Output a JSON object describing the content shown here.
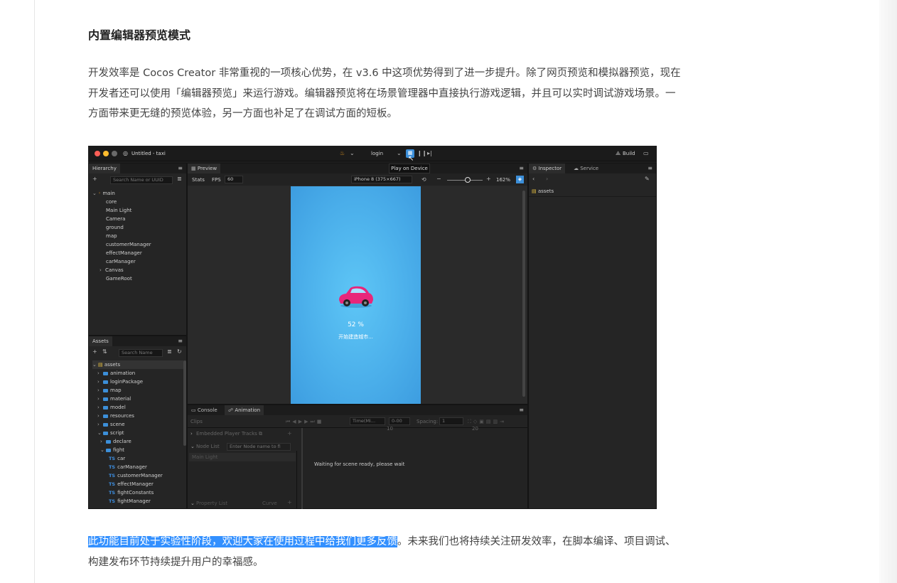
{
  "article": {
    "title": "内置编辑器预览模式",
    "paragraph1": "开发效率是 Cocos Creator 非常重视的一项核心优势，在 v3.6 中这项优势得到了进一步提升。除了网页预览和模拟器预览，现在开发者还可以使用「编辑器预览」来运行游戏。编辑器预览将在场景管理器中直接执行游戏逻辑，并且可以实时调试游戏场景。一方面带来更无缝的预览体验，另一方面也补足了在调试方面的短板。",
    "paragraph2_highlight": "此功能目前处于实验性阶段，欢迎大家在使用过程中给我们更多反馈",
    "paragraph2_rest": "。未来我们也将持续关注研发效率，在脚本编译、项目调试、构建发布环节持续提升用户的幸福感。"
  },
  "editor": {
    "window_title": "Untitled - taxi",
    "scene_select": "login",
    "tooltip": "Play on Device",
    "build_label": "Build",
    "hierarchy": {
      "tab": "Hierarchy",
      "search_placeholder": "Search Name or UUID",
      "root": "main",
      "items": [
        "core",
        "Main Light",
        "Camera",
        "ground",
        "map",
        "customerManager",
        "effectManager",
        "carManager",
        "Canvas",
        "GameRoot"
      ]
    },
    "assets": {
      "tab": "Assets",
      "search_placeholder": "Search Name",
      "root": "assets",
      "folders": [
        "animation",
        "loginPackage",
        "map",
        "material",
        "model",
        "resources",
        "scene",
        "script"
      ],
      "script_children": [
        "declare",
        "fight"
      ],
      "ts_label": "TS",
      "files": [
        "car",
        "carManager",
        "customerManager",
        "effectManager",
        "fightConstants",
        "fightManager"
      ]
    },
    "preview": {
      "tab": "Preview",
      "stats_label": "Stats",
      "fps_label": "FPS",
      "fps_value": "60",
      "device": "iPhone 8 (375×667)",
      "zoom": "162%",
      "progress_text": "52 %",
      "loading_text": "开始建造城市..."
    },
    "inspector": {
      "tab": "Inspector",
      "service_tab": "Service",
      "path": "assets"
    },
    "bottom": {
      "console_tab": "Console",
      "animation_tab": "Animation",
      "clips_label": "Clips",
      "time_label": "Time(Mi...",
      "time_value": "0-00",
      "spacing_label": "Spacing:",
      "spacing_value": "1",
      "embedded_tracks": "Embedded Player Tracks",
      "node_list": "Node List",
      "node_placeholder": "Enter Node name to fi",
      "node_item": "Main Light",
      "waiting_text": "Waiting for scene ready, please wait",
      "property_list": "Property List",
      "curve_label": "Curve",
      "tick_10": "10",
      "tick_20": "20"
    }
  }
}
